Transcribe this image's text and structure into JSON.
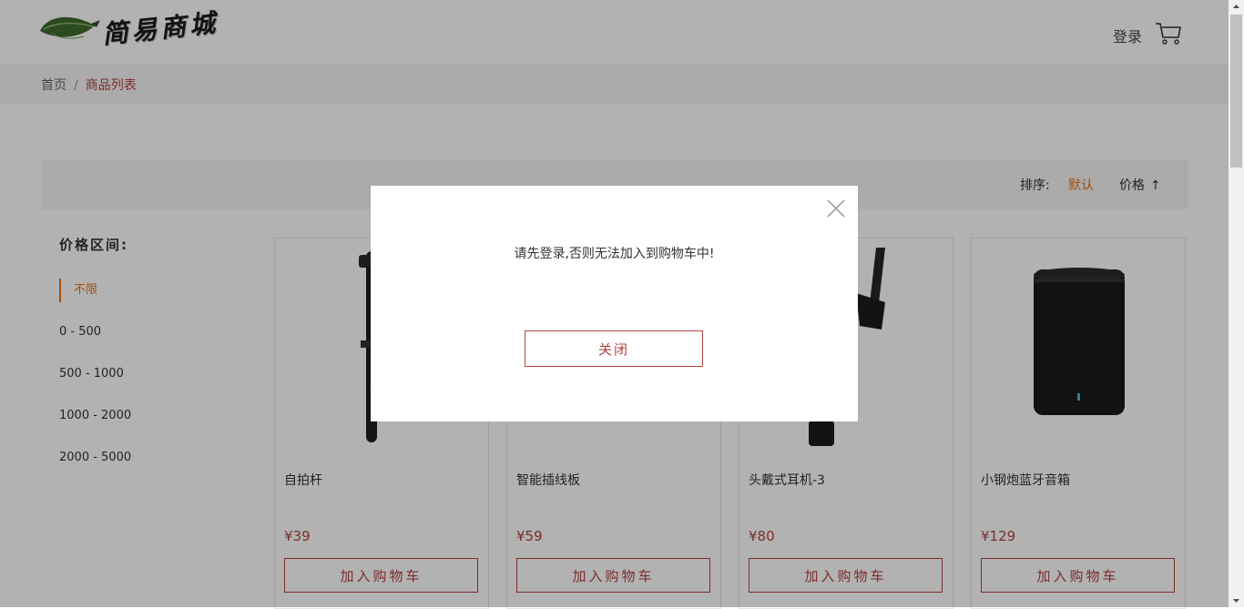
{
  "header": {
    "logo_text": "简易商城",
    "login_label": "登录"
  },
  "breadcrumb": {
    "home": "首页",
    "separator": "/",
    "current": "商品列表"
  },
  "sort": {
    "label": "排序:",
    "default_label": "默认",
    "price_label": "价格",
    "price_arrow": "↑"
  },
  "filter": {
    "title": "价格区间:",
    "options": [
      "不限",
      "0 - 500",
      "500 - 1000",
      "1000 - 2000",
      "2000 - 5000"
    ],
    "selected": "不限"
  },
  "products": [
    {
      "name": "自拍杆",
      "price": "¥39",
      "button": "加入购物车"
    },
    {
      "name": "智能插线板",
      "price": "¥59",
      "button": "加入购物车"
    },
    {
      "name": "头戴式耳机-3",
      "price": "¥80",
      "button": "加入购物车"
    },
    {
      "name": "小钢炮蓝牙音箱",
      "price": "¥129",
      "button": "加入购物车"
    }
  ],
  "modal": {
    "message": "请先登录,否则无法加入到购物车中!",
    "close_button": "关闭"
  },
  "colors": {
    "accent": "#b0413e",
    "active_orange": "#e8731a",
    "overlay": "rgba(0,0,0,0.30)"
  }
}
